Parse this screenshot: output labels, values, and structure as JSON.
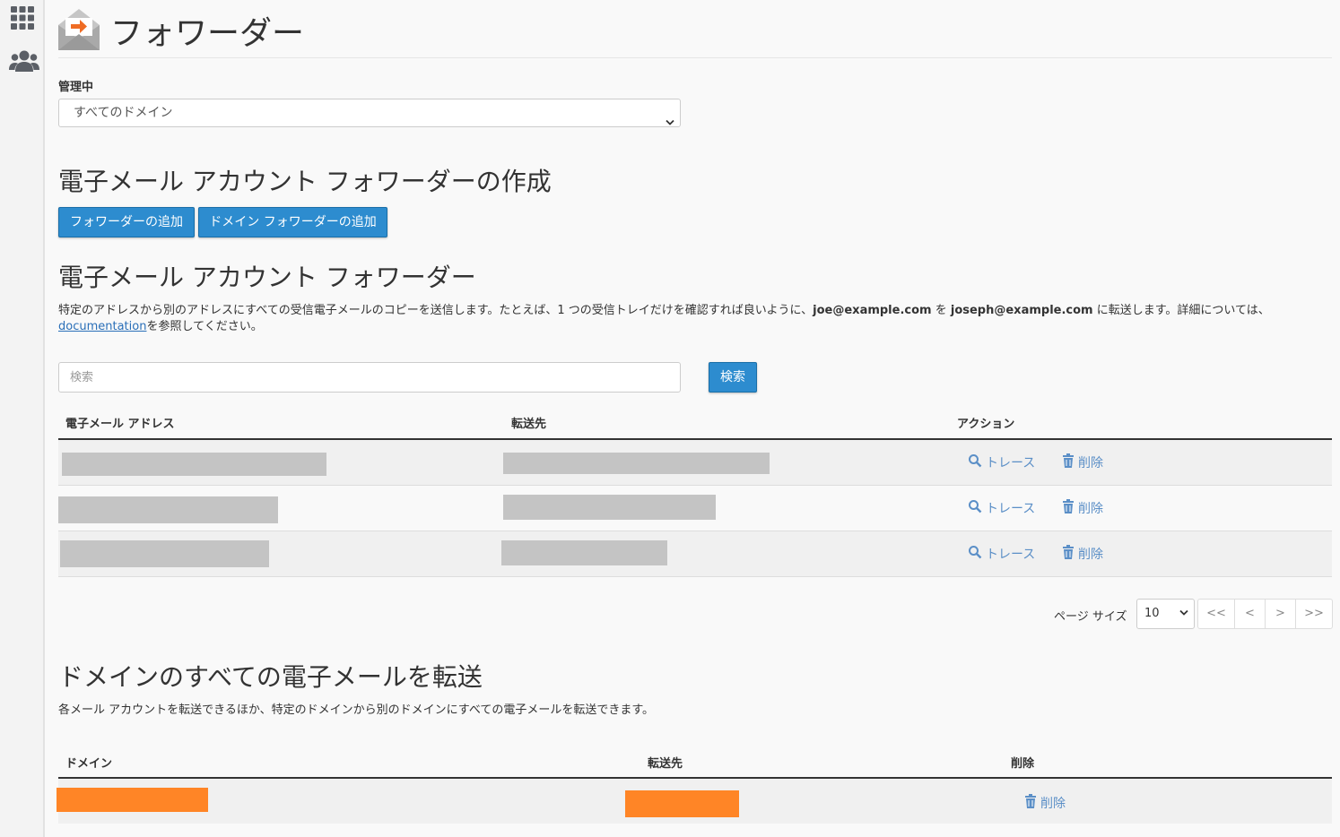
{
  "page": {
    "title": "フォワーダー"
  },
  "manage": {
    "label": "管理中",
    "selected": "すべてのドメイン"
  },
  "create_section": {
    "title": "電子メール アカウント フォワーダーの作成",
    "add_forwarder_button": "フォワーダーの追加",
    "add_domain_forwarder_button": "ドメイン フォワーダーの追加"
  },
  "account_forwarders": {
    "title": "電子メール アカウント フォワーダー",
    "desc_part1": "特定のアドレスから別のアドレスにすべての受信電子メールのコピーを送信します。たとえば、1 つの受信トレイだけを確認すれば良いように、",
    "desc_email1": "joe@example.com",
    "desc_part2": " を ",
    "desc_email2": "joseph@example.com",
    "desc_part3": " に転送します。詳細については、",
    "desc_link": "documentation",
    "desc_part4": "を参照してください。",
    "search_placeholder": "検索",
    "search_button": "検索",
    "columns": {
      "email": "電子メール アドレス",
      "forward_to": "転送先",
      "actions": "アクション"
    },
    "rows": [
      {
        "trace": "トレース",
        "delete": "削除"
      },
      {
        "trace": "トレース",
        "delete": "削除"
      },
      {
        "trace": "トレース",
        "delete": "削除"
      }
    ],
    "pagination": {
      "page_size_label": "ページ サイズ",
      "page_size": "10",
      "first": "<<",
      "prev": "<",
      "next": ">",
      "last": ">>"
    }
  },
  "domain_forwarders": {
    "title": "ドメインのすべての電子メールを転送",
    "desc": "各メール アカウントを転送できるほか、特定のドメインから別のドメインにすべての電子メールを転送できます。",
    "columns": {
      "domain": "ドメイン",
      "forward_to": "転送先",
      "delete": "削除"
    },
    "rows": [
      {
        "delete": "削除"
      }
    ]
  },
  "colors": {
    "primary_button": "#2d8ccf",
    "link": "#5b8fc7",
    "redaction_gray": "#c4c4c4",
    "redaction_orange": "#ff8526",
    "icon_orange": "#ef6c24"
  },
  "icons": {
    "sidebar_grid": "grid-icon",
    "sidebar_users": "users-icon",
    "app": "envelope-forward-icon",
    "trace": "search-icon",
    "delete": "trash-icon"
  }
}
